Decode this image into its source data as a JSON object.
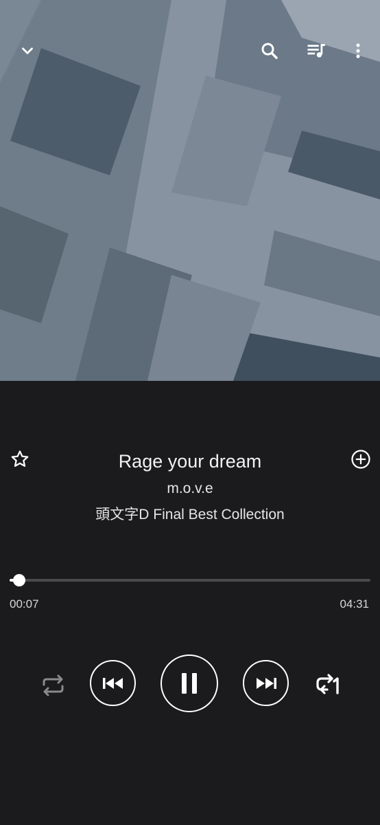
{
  "topbar": {
    "collapse_icon": "chevron-down-icon",
    "search_icon": "search-icon",
    "queue_icon": "queue-music-icon",
    "more_icon": "more-vert-icon"
  },
  "track": {
    "title": "Rage your dream",
    "artist": "m.o.v.e",
    "album": "頭文字D Final Best Collection"
  },
  "progress": {
    "elapsed": "00:07",
    "duration": "04:31",
    "fraction": 0.026
  },
  "controls": {
    "shuffle_icon": "shuffle-icon",
    "previous_icon": "skip-previous-icon",
    "play_pause_icon": "pause-icon",
    "next_icon": "skip-next-icon",
    "repeat_icon": "repeat-one-icon"
  },
  "colors": {
    "background": "#1b1b1d",
    "art_base": "#8793a0",
    "accent": "#ffffff"
  }
}
